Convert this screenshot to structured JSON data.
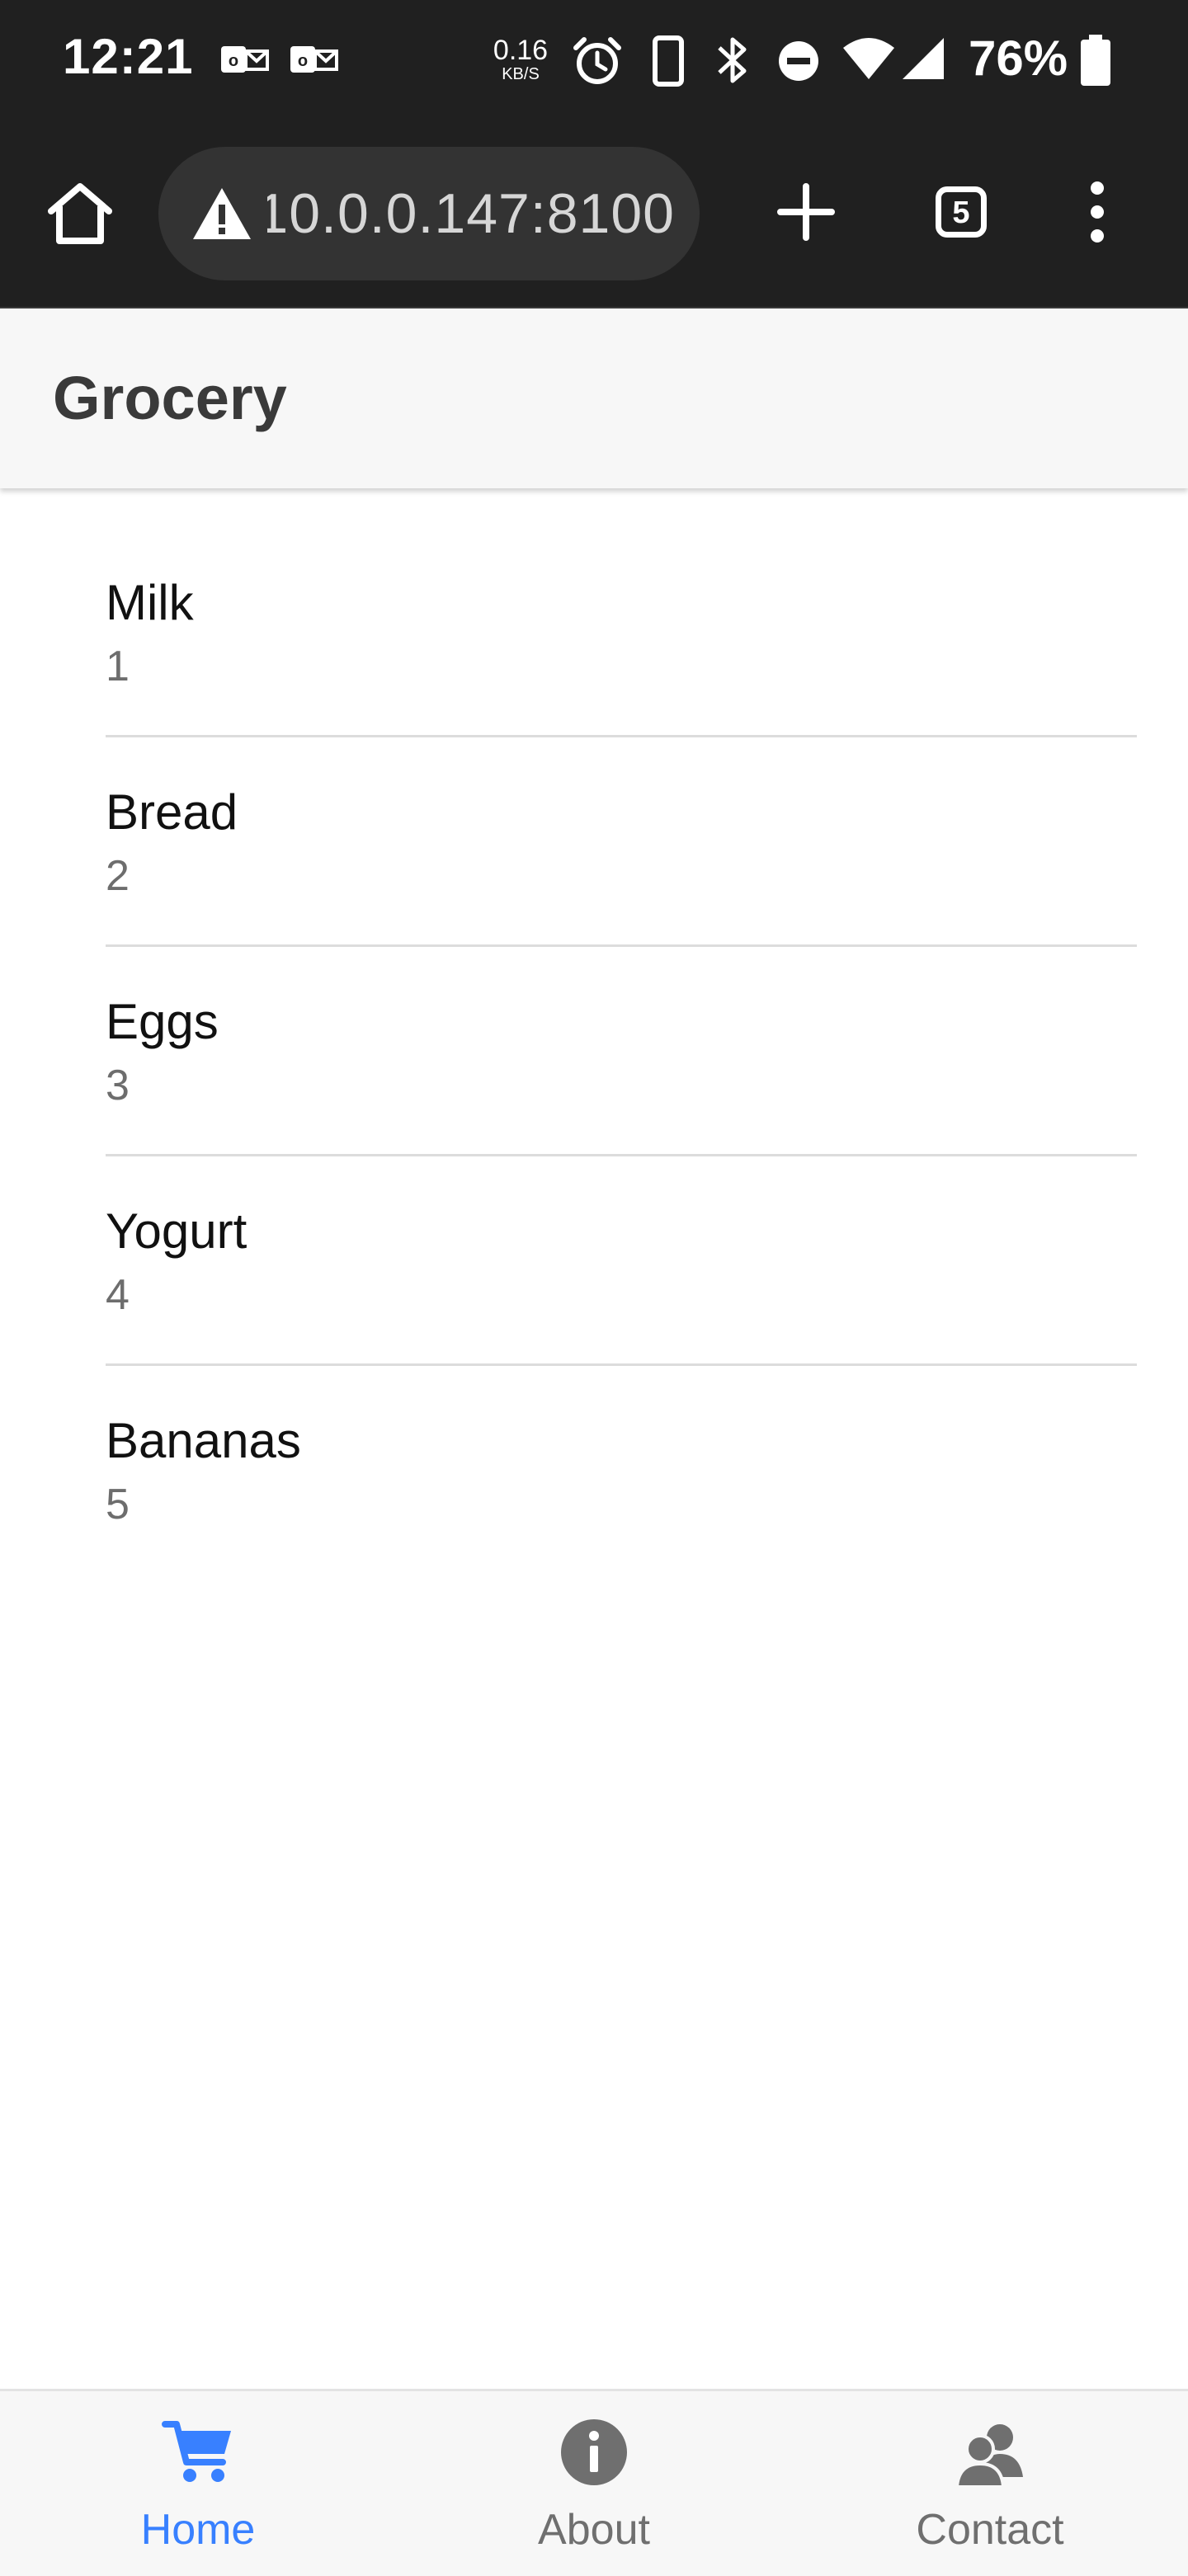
{
  "status_bar": {
    "time": "12:21",
    "net_speed_value": "0.16",
    "net_speed_unit": "KB/S",
    "battery_percent": "76%"
  },
  "browser": {
    "url": "10.0.0.147:8100",
    "tab_count": "5"
  },
  "header": {
    "title": "Grocery"
  },
  "groceries": [
    {
      "name": "Milk",
      "qty": "1"
    },
    {
      "name": "Bread",
      "qty": "2"
    },
    {
      "name": "Eggs",
      "qty": "3"
    },
    {
      "name": "Yogurt",
      "qty": "4"
    },
    {
      "name": "Bananas",
      "qty": "5"
    }
  ],
  "tabs": [
    {
      "label": "Home",
      "icon": "cart-icon",
      "active": true
    },
    {
      "label": "About",
      "icon": "info-icon",
      "active": false
    },
    {
      "label": "Contact",
      "icon": "people-icon",
      "active": false
    }
  ],
  "colors": {
    "accent": "#3880ff",
    "status_bar_bg": "#202020",
    "header_bg": "#f7f7f7"
  }
}
